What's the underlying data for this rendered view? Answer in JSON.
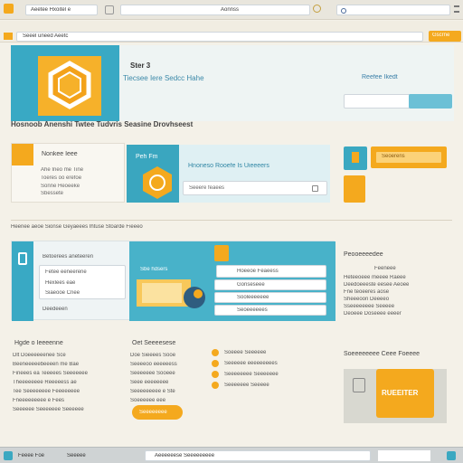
{
  "browser": {
    "tab_title": "Aeetee Hxoitel e",
    "address_text": "Aonnss",
    "search_placeholder": "",
    "url_text": "Seeel uneed Aeetc",
    "go_label": "Gscrne"
  },
  "header": {
    "brand": "Ster 3",
    "subtitle": "Tiecsee Iere Sedcc Hahe",
    "search_label": "Reefee Ikedt",
    "search_value": "",
    "search_button": ""
  },
  "section1": {
    "title": "Hosnoob Anenshi Twtee Tudvris Seasine Drovhseest"
  },
  "card1": {
    "label": "Nonkee Ieee",
    "lines": [
      "Ahe Ineo me Tine",
      "Toeres oo erefoe",
      "Sonne Heoeeke",
      "Sbessete"
    ]
  },
  "card2": {
    "label": "Peh  Fm",
    "title": "Hnoneso Rooefe Is Uieeeers",
    "input_value": "Seeere feaees"
  },
  "side_widget": {
    "button_label": "Seoerens"
  },
  "section2": {
    "title": "Heenee aeoe Sionse Geyaeees Ihtuse Stoarde Fieeeo"
  },
  "panel": {
    "left_lines": [
      "Betoerees aneteeren",
      "Fetee eeneerene",
      "Hexlees eae",
      "Siaeooe Cnee"
    ],
    "left_button": "Deedeeen",
    "tab1": "Sbe hdsers",
    "search_value": "Hoeeoe Feaeess",
    "search_button": "Sewers",
    "rows": [
      "Gonseseee",
      "Sooleeeeeee",
      "Seoeeeeees"
    ],
    "right_title": "Peooeeeedee",
    "right_lines": [
      "Feeneee",
      "Heteeoeee meeee Raeee",
      "Deedoeeeste eesee Aeoee",
      "Fne teoeeres aose",
      "Sheeeoon Deeeeo",
      "Sseeeeeeee Seeeee",
      "Deoeee Doseeee eeeer"
    ]
  },
  "bottom": {
    "col1_title": "Hgde o Ieeeenne",
    "col1_lines": [
      "Dlt  Doeeeeeenee Sce",
      "Beeneeeeebeeeen me Bae",
      "Fineees ea Teeeees Seeeeeee",
      "Theeeeeeee Reeeeess ae",
      "Tee Seeeeeeee Feeeeeeee",
      "Fneeeeeeeee e Fees",
      "Seeeeee Seeeeeee Seeeeee"
    ],
    "col2_title": "Oet Seeeesese",
    "col2_lines": [
      "Doe Sieeees Sooe",
      "Seeeeoo eeeeeess",
      "Seeeeeee Sooeee",
      "Seee  eeeeeeee",
      "Seeeeeeeee e Ste",
      "Soeeeeee eee"
    ],
    "col2_button": "Seeeeeeee",
    "col3_items": [
      "Soeeee Seeeeee",
      "Seeeeee eeeeeeeees",
      "Seeeeeeee Seeeeeee",
      "Seeeeeee Seeeee"
    ],
    "promo_title": "Soeeeeeeee Ceee Foeeee",
    "promo_label": "RUEEITER"
  },
  "taskbar": {
    "items": [
      "Feeee Foe",
      "Seeeee",
      "Aeeeeeese Seeeeeeeee"
    ]
  },
  "colors": {
    "accent_teal": "#3aa8c1",
    "accent_orange": "#f4a91e",
    "background": "#f4f1e8"
  }
}
